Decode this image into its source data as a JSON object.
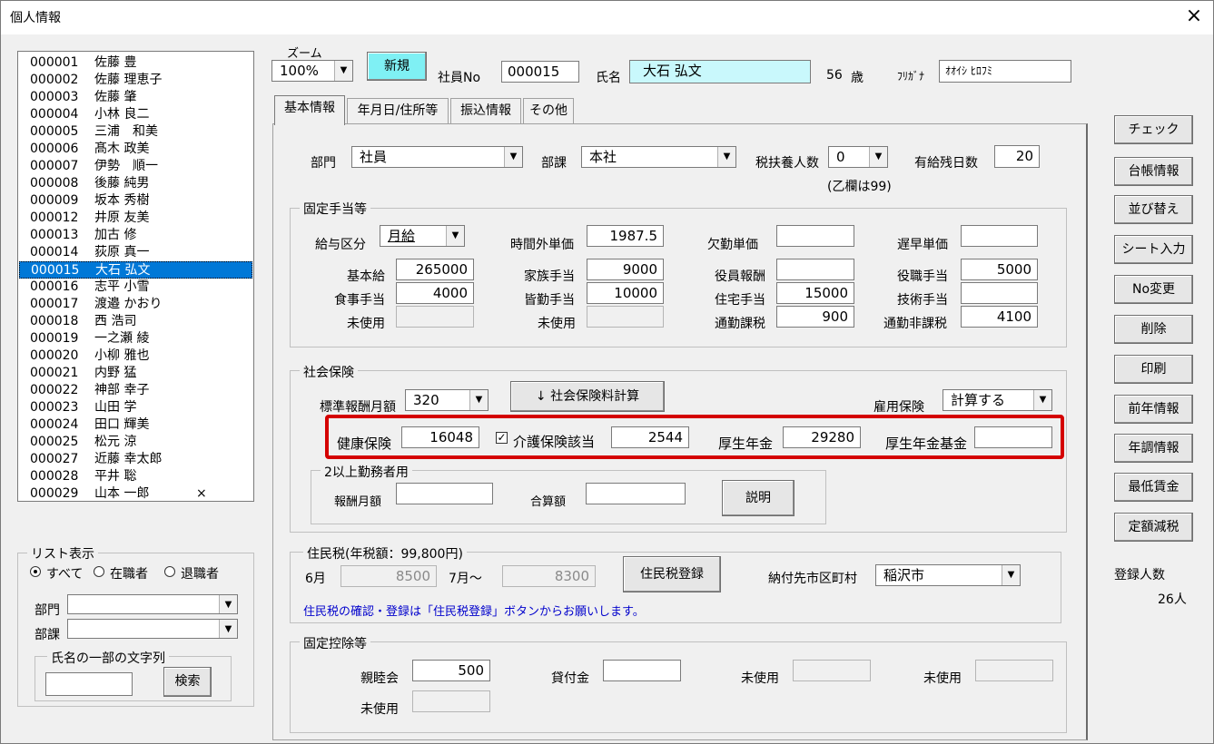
{
  "window": {
    "title": "個人情報",
    "close": "×"
  },
  "employees": [
    {
      "code": "000001",
      "name": "佐藤 豊"
    },
    {
      "code": "000002",
      "name": "佐藤 理恵子"
    },
    {
      "code": "000003",
      "name": "佐藤 肇"
    },
    {
      "code": "000004",
      "name": "小林 良二"
    },
    {
      "code": "000005",
      "name": "三浦　和美"
    },
    {
      "code": "000006",
      "name": "髙木 政美"
    },
    {
      "code": "000007",
      "name": "伊勢　順一"
    },
    {
      "code": "000008",
      "name": "後藤 純男"
    },
    {
      "code": "000009",
      "name": "坂本 秀樹"
    },
    {
      "code": "000012",
      "name": "井原 友美"
    },
    {
      "code": "000013",
      "name": "加古 修"
    },
    {
      "code": "000014",
      "name": "荻原 真一"
    },
    {
      "code": "000015",
      "name": "大石 弘文"
    },
    {
      "code": "000016",
      "name": "志平 小雪"
    },
    {
      "code": "000017",
      "name": "渡邉 かおり"
    },
    {
      "code": "000018",
      "name": "西 浩司"
    },
    {
      "code": "000019",
      "name": "一之瀬 綾"
    },
    {
      "code": "000020",
      "name": "小柳 雅也"
    },
    {
      "code": "000021",
      "name": "内野 猛"
    },
    {
      "code": "000022",
      "name": "神部 幸子"
    },
    {
      "code": "000023",
      "name": "山田 学"
    },
    {
      "code": "000024",
      "name": "田口 輝美"
    },
    {
      "code": "000025",
      "name": "松元 涼"
    },
    {
      "code": "000027",
      "name": "近藤 幸太郎"
    },
    {
      "code": "000028",
      "name": "平井 聡"
    },
    {
      "code": "000029",
      "name": "山本 一郎",
      "mark": "×"
    }
  ],
  "list_display": {
    "title": "リスト表示",
    "opt_all": "すべて",
    "opt_active": "在職者",
    "opt_retired": "退職者",
    "dept_label": "部門",
    "section_label": "部課",
    "partial_name_title": "氏名の一部の文字列",
    "search_btn": "検索"
  },
  "header": {
    "zoom_label": "ズーム",
    "zoom_value": "100%",
    "new_btn": "新規",
    "empno_label": "社員No",
    "empno": "000015",
    "name_label": "氏名",
    "name": "大石 弘文",
    "age": "56",
    "age_unit": "歳",
    "kana_label": "ﾌﾘｶﾞﾅ",
    "kana": "ｵｵｲｼ ﾋﾛﾌﾐ"
  },
  "tabs": [
    "基本情報",
    "年月日/住所等",
    "振込情報",
    "その他"
  ],
  "basic": {
    "dept_label": "部門",
    "dept": "社員",
    "section_label": "部課",
    "section": "本社",
    "dependents_label": "税扶養人数",
    "dependents": "0",
    "dependents_note": "(乙欄は99)",
    "paid_leave_label": "有給残日数",
    "paid_leave": "20"
  },
  "allowances": {
    "title": "固定手当等",
    "pay_type_label": "給与区分",
    "pay_type": "月給",
    "overtime_label": "時間外単価",
    "overtime": "1987.5",
    "absence_label": "欠勤単価",
    "absence": "",
    "late_label": "遅早単価",
    "late": "",
    "base_label": "基本給",
    "base": "265000",
    "family_label": "家族手当",
    "family": "9000",
    "officer_label": "役員報酬",
    "officer": "",
    "position_label": "役職手当",
    "position": "5000",
    "meal_label": "食事手当",
    "meal": "4000",
    "attendance_label": "皆勤手当",
    "attendance": "10000",
    "housing_label": "住宅手当",
    "housing": "15000",
    "skill_label": "技術手当",
    "skill": "",
    "unused1_label": "未使用",
    "unused2_label": "未使用",
    "commute_tax_label": "通勤課税",
    "commute_tax": "900",
    "commute_nontax_label": "通勤非課税",
    "commute_nontax": "4100"
  },
  "insurance": {
    "title": "社会保険",
    "std_label": "標準報酬月額",
    "std": "320",
    "calc_btn": "↓  社会保険料計算",
    "employment_label": "雇用保険",
    "employment": "計算する",
    "health_label": "健康保険",
    "health": "16048",
    "care_label": "介護保険該当",
    "care_checked": "✓",
    "care": "2544",
    "pension_label": "厚生年金",
    "pension": "29280",
    "fund_label": "厚生年金基金",
    "fund": "",
    "multi_title": "2以上勤務者用",
    "multi_pay_label": "報酬月額",
    "multi_pay": "",
    "multi_total_label": "合算額",
    "multi_total": "",
    "explain_btn": "説明"
  },
  "resident_tax": {
    "title": "住民税(年税額：99,800円)",
    "june_label": "6月",
    "june": "8500",
    "july_label": "7月～",
    "july": "8300",
    "register_btn": "住民税登録",
    "city_label": "納付先市区町村",
    "city": "稲沢市",
    "note": "住民税の確認・登録は「住民税登録」ボタンからお願いします。"
  },
  "deductions": {
    "title": "固定控除等",
    "social_label": "親睦会",
    "social": "500",
    "loan_label": "貸付金",
    "loan": "",
    "unused1_label": "未使用",
    "unused2_label": "未使用",
    "unused3_label": "未使用"
  },
  "side_buttons": [
    "チェック",
    "台帳情報",
    "並び替え",
    "シート入力",
    "No変更",
    "削除",
    "印刷",
    "前年情報",
    "年調情報",
    "最低賃金",
    "定額減税"
  ],
  "registered": {
    "label": "登録人数",
    "count": "26人"
  },
  "colors": {
    "selection": "#0078d7",
    "name_bg": "#c9f8fc",
    "new_btn": "#7ff0f4",
    "highlight": "#d40000",
    "note": "#0000cc"
  }
}
